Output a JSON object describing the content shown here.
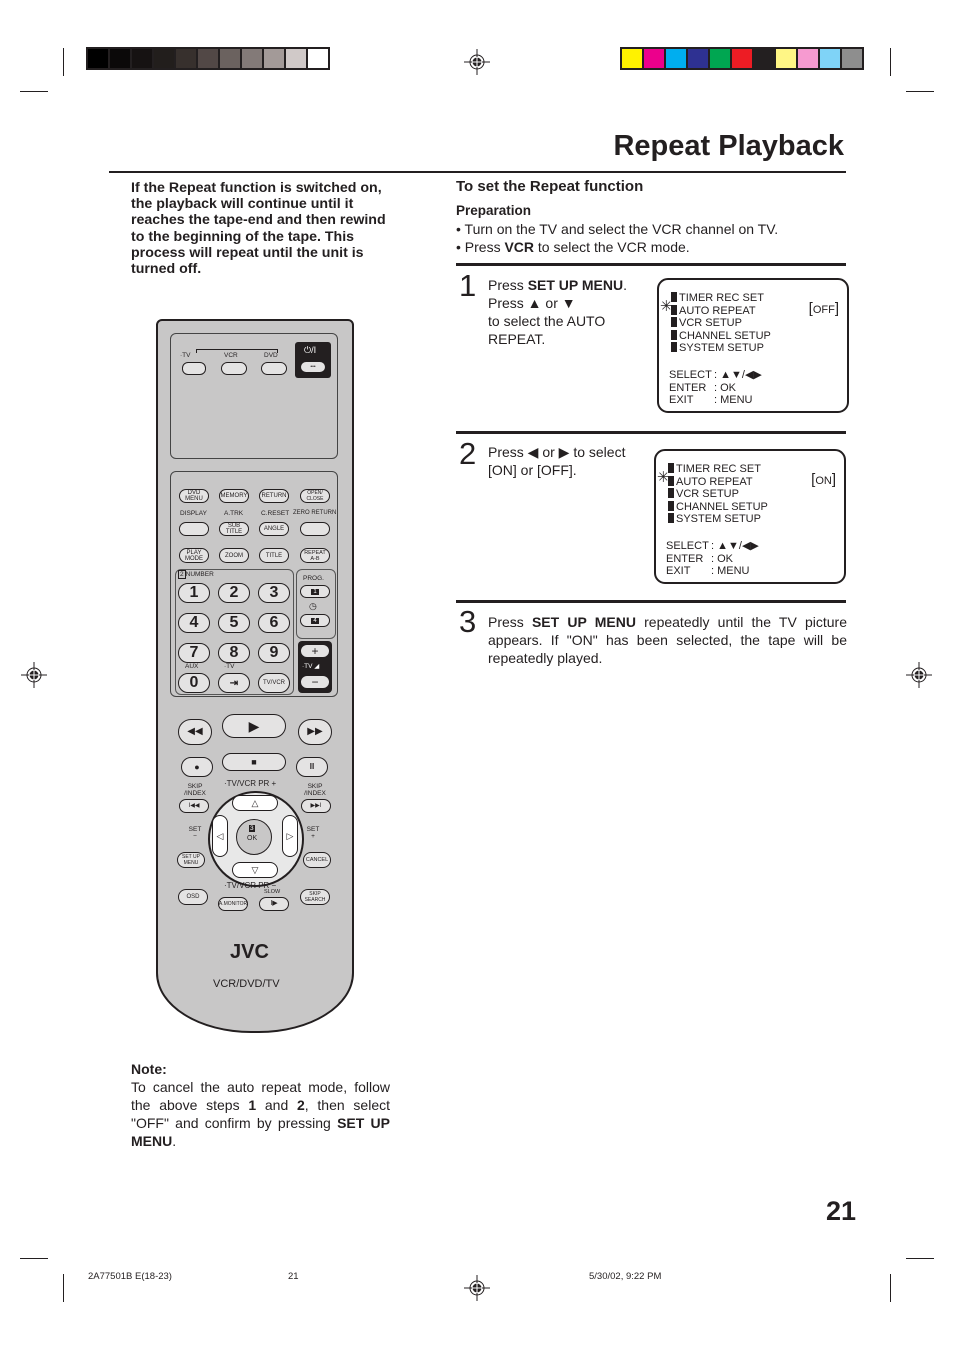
{
  "calibration": {
    "grayscale": [
      "#000000",
      "#0b0909",
      "#161212",
      "#221e1c",
      "#37302d",
      "#524846",
      "#6b625f",
      "#837a78",
      "#a39a98",
      "#d0c9c8",
      "#ffffff"
    ],
    "color": [
      "#fff200",
      "#ec008c",
      "#00aeef",
      "#2e3192",
      "#00a651",
      "#ed1c24",
      "#231f20",
      "#fff685",
      "#f69ad0",
      "#7fd3f7",
      "#8e8e8e"
    ]
  },
  "page": {
    "title": "Repeat Playback",
    "number": "21",
    "intro": "If the Repeat function is switched on, the playback will continue until it reaches the tape-end and then rewind to the beginning of the tape. This process will repeat until the unit is turned off."
  },
  "section": {
    "heading": "To set the Repeat function",
    "preparation_heading": "Preparation",
    "preparation": [
      {
        "pre": "• Turn on the TV and select the VCR channel on TV.",
        "bold": "",
        "post": ""
      },
      {
        "pre": "• Press ",
        "bold": "VCR",
        "post": " to select the VCR mode."
      }
    ]
  },
  "steps": [
    {
      "number": "1",
      "lines": [
        "Press SET UP MENU.",
        "Press ▲ or ▼",
        "to select the AUTO",
        "REPEAT."
      ],
      "bold_term": "SET UP MENU",
      "osd": {
        "menu": [
          "TIMER  REC  SET",
          "AUTO  REPEAT",
          "VCR  SETUP",
          "CHANNEL  SETUP",
          "SYSTEM  SETUP"
        ],
        "selected_index": 1,
        "value": "OFF",
        "keys": [
          {
            "label": "SELECT",
            "value": ": ▲▼/◀▶"
          },
          {
            "label": "ENTER",
            "value": ": OK"
          },
          {
            "label": "EXIT",
            "value": ": MENU"
          }
        ]
      }
    },
    {
      "number": "2",
      "lines": [
        "Press ◀  or  ▶ to select",
        "[ON] or [OFF]."
      ],
      "osd": {
        "menu": [
          "TIMER  REC  SET",
          "AUTO  REPEAT",
          "VCR  SETUP",
          "CHANNEL  SETUP",
          "SYSTEM  SETUP"
        ],
        "selected_index": 1,
        "value": "ON",
        "keys": [
          {
            "label": "SELECT",
            "value": ": ▲▼/◀▶"
          },
          {
            "label": "ENTER",
            "value": ": OK"
          },
          {
            "label": "EXIT",
            "value": ": MENU"
          }
        ]
      }
    },
    {
      "number": "3",
      "pre": "Press ",
      "bold": "SET UP MENU",
      "post": " repeatedly until the TV picture appears. If \"ON\" has been selected, the tape will be repeatedly played."
    }
  ],
  "note": {
    "heading": "Note:",
    "t1": "To cancel the auto repeat mode, follow the above steps ",
    "b1": "1",
    "t2": " and ",
    "b2": "2",
    "t3": ", then select \"OFF\" and confirm by pressing ",
    "b3": "SET UP MENU",
    "t4": "."
  },
  "remote": {
    "brand": "JVC",
    "model_label": "VCR/DVD/TV",
    "mode_labels": {
      "tv": "·TV",
      "vcr": "VCR",
      "dvd": "DVD",
      "power": "⏻/I",
      "power_dots": "•••"
    },
    "row1": [
      "DVD MENU",
      "MEMORY",
      "RETURN",
      "OPEN/ CLOSE"
    ],
    "row2_labels": [
      "DISPLAY",
      "A.TRK",
      "C.RESET",
      "ZERO RETURN"
    ],
    "row2": [
      "",
      "SUB TITLE",
      "ANGLE",
      ""
    ],
    "row3": [
      "PLAY MODE",
      "ZOOM",
      "TITLE",
      "REPEAT A-B"
    ],
    "number_label": "NUMBER",
    "number_step": "2",
    "digits": [
      "1",
      "2",
      "3",
      "4",
      "5",
      "6",
      "7",
      "8",
      "9",
      "0"
    ],
    "aux_label": "AUX",
    "tv_label": "·TV",
    "tvvcr": "TV/VCR",
    "prog_label": "PROG.",
    "prog_keys": [
      "1",
      "4"
    ],
    "vol_plus": "+",
    "vol_minus": "−",
    "vol_label": "·TV ◢",
    "transport": {
      "rew": "◀◀",
      "play": "▶",
      "ff": "▶▶",
      "rec": "●",
      "stop": "■",
      "pause": "II"
    },
    "skip_left": "SKIP /INDEX",
    "skip_right": "SKIP /INDEX",
    "pr_plus": "·TV/VCR PR +",
    "pr_minus": "·TV/VCR PR −",
    "set_minus": "SET −",
    "set_plus": "SET +",
    "ok_step": "3",
    "ok": "OK",
    "setup_menu": "SET UP MENU",
    "cancel": "CANCEL",
    "osd": "OSD",
    "amonitor": "A.MONITOR",
    "slow_label": "SLOW",
    "slow": "I▶",
    "skip_search": "SKIP SEARCH"
  },
  "footer": {
    "code": "2A77501B E(18-23)",
    "page": "21",
    "timestamp": "5/30/02, 9:22 PM"
  }
}
